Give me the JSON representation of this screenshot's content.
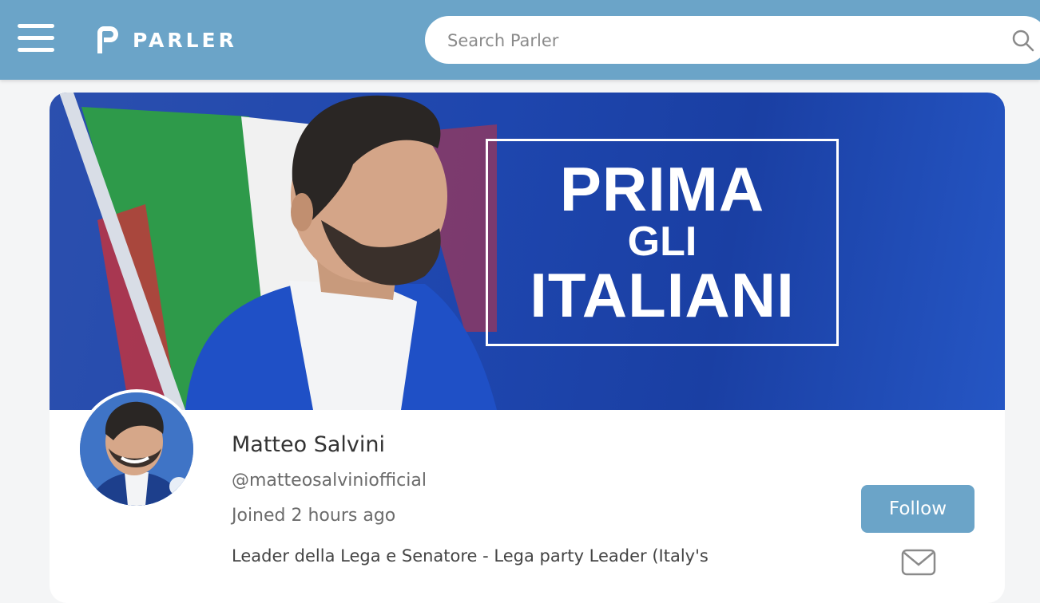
{
  "header": {
    "brand": "PARLER",
    "menu_icon": "hamburger-menu-icon",
    "logo_icon": "parler-p-logo-icon",
    "search_placeholder": "Search Parler",
    "search_icon": "search-icon"
  },
  "banner": {
    "line1": "PRIMA",
    "line2": "GLI",
    "line3": "ITALIANI"
  },
  "profile": {
    "name": "Matteo Salvini",
    "handle": "@matteosalviniofficial",
    "joined": "Joined 2 hours ago",
    "bio": "Leader della Lega e Senatore - Lega party Leader (Italy's"
  },
  "actions": {
    "follow_label": "Follow",
    "message_icon": "mail-icon"
  },
  "colors": {
    "accent": "#6ba4c8",
    "banner_blue": "#1e46ae",
    "flag_green": "#2e9a4a",
    "flag_red": "#c8323a"
  }
}
